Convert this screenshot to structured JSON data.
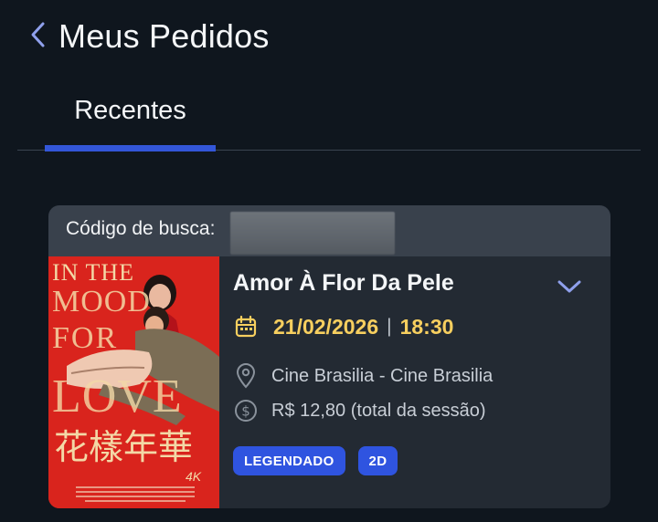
{
  "header": {
    "back_icon": "chevron-left-icon",
    "title": "Meus Pedidos"
  },
  "tabs": [
    {
      "label": "Recentes",
      "active": true
    }
  ],
  "order": {
    "code_label": "Código de busca:",
    "movie_title": "Amor À Flor Da Pele",
    "date": "21/02/2026",
    "separator": "|",
    "time": "18:30",
    "location": "Cine Brasilia - Cine Brasilia",
    "price": "R$ 12,80 (total da sessão)",
    "badges": [
      "LEGENDADO",
      "2D"
    ],
    "poster": {
      "title_lines": [
        "IN THE",
        "MOOD",
        "FOR",
        "LOVE"
      ],
      "chinese_title": "花樣年華",
      "tag": "4K"
    }
  },
  "colors": {
    "background": "#0f161e",
    "accent": "#3356d8",
    "date_highlight": "#f7cf5f",
    "card": "#232a33",
    "card_header": "#39414c",
    "badge": "#2f54e0",
    "poster_red": "#d9241d"
  }
}
